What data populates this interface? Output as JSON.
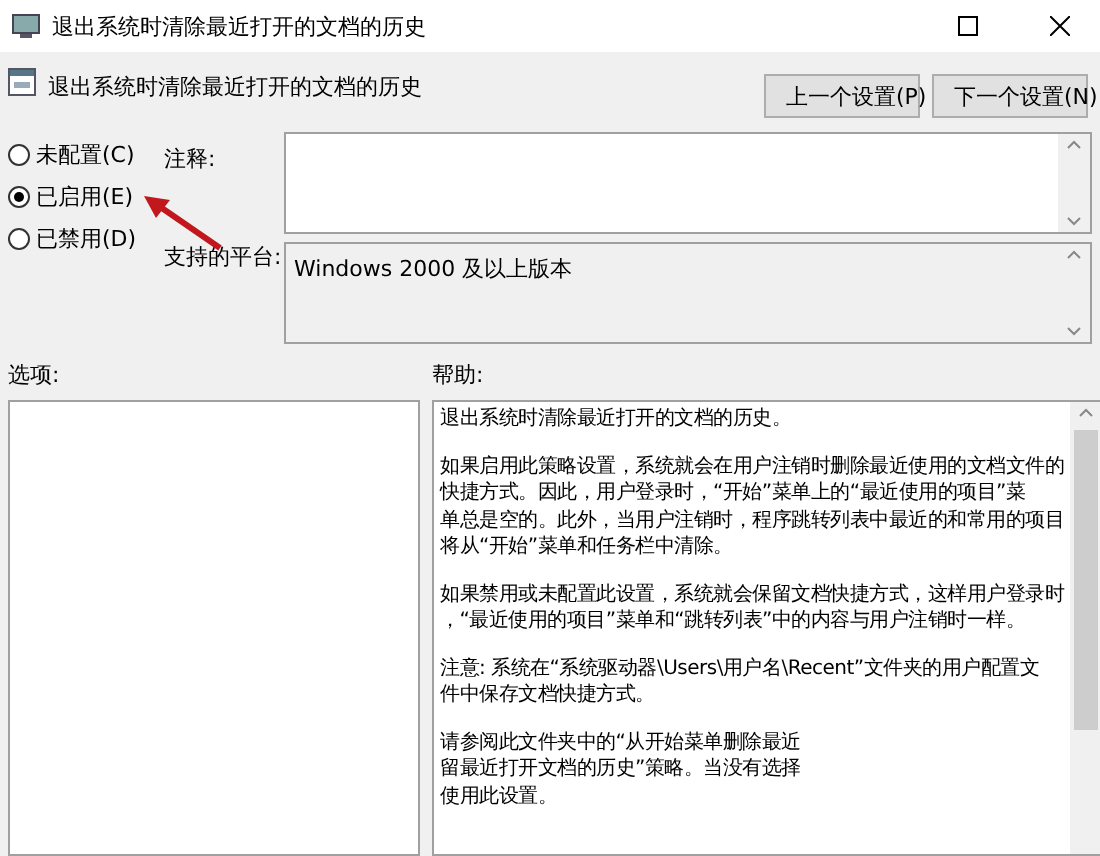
{
  "window": {
    "title": "退出系统时清除最近打开的文档的历史"
  },
  "header": {
    "title": "退出系统时清除最近打开的文档的历史",
    "buttons": [
      "上一个设置(P)",
      "下一个设置(N)"
    ]
  },
  "radios": [
    {
      "label": "未配置(C)",
      "selected": false
    },
    {
      "label": "已启用(E)",
      "selected": true
    },
    {
      "label": "已禁用(D)",
      "selected": false
    }
  ],
  "comment": {
    "label": "注释:"
  },
  "platform": {
    "label": "支持的平台:",
    "value": "Windows 2000 及以上版本"
  },
  "options": {
    "label": "选项:"
  },
  "help": {
    "label": "帮助:",
    "paragraphs": [
      [
        "退出系统时清除最近打开的文档的历史。"
      ],
      [
        "如果启用此策略设置，系统就会在用户注销时删除最近使用的文档文件的",
        "快捷方式。因此，用户登录时，“开始”菜单上的“最近使用的项目”菜",
        "单总是空的。此外，当用户注销时，程序跳转列表中最近的和常用的项目",
        "将从“开始”菜单和任务栏中清除。"
      ],
      [
        "如果禁用或未配置此设置，系统就会保留文档快捷方式，这样用户登录时",
        "，“最近使用的项目”菜单和“跳转列表”中的内容与用户注销时一样。"
      ],
      [
        "注意: 系统在“系统驱动器\\Users\\用户名\\Recent”文件夹的用户配置文",
        "件中保存文档快捷方式。"
      ],
      [
        "请参阅此文件夹中的“从开始菜单删除最近",
        "留最近打开文档的历史”策略。当没有选择",
        "使用此设置。"
      ]
    ]
  }
}
